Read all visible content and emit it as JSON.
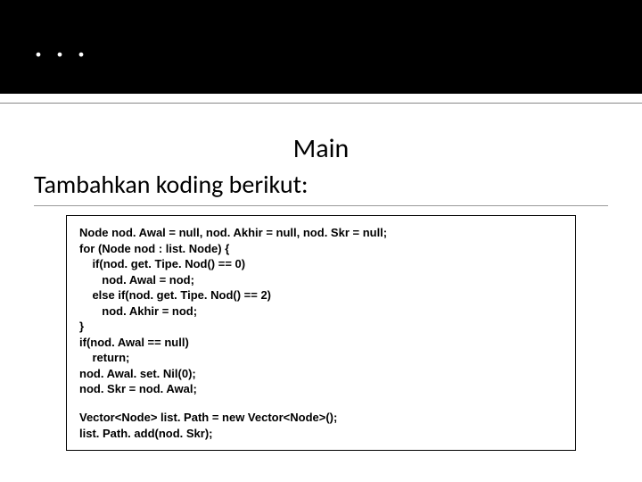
{
  "title": ". . .",
  "subtitle": "Main",
  "instruction": "Tambahkan koding berikut:",
  "code": {
    "l1": "Node nod. Awal = null, nod. Akhir = null, nod. Skr = null;",
    "l2": "for (Node nod : list. Node) {",
    "l3": "    if(nod. get. Tipe. Nod() == 0)",
    "l4": "       nod. Awal = nod;",
    "l5": "    else if(nod. get. Tipe. Nod() == 2)",
    "l6": "       nod. Akhir = nod;",
    "l7": "}",
    "l8": "if(nod. Awal == null)",
    "l9": "    return;",
    "l10": "nod. Awal. set. Nil(0);",
    "l11": "nod. Skr = nod. Awal;",
    "l12": "Vector<Node> list. Path = new Vector<Node>();",
    "l13": "list. Path. add(nod. Skr);"
  }
}
